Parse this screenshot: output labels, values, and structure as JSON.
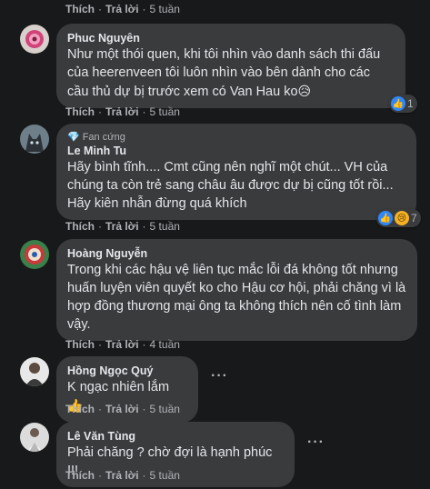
{
  "labels": {
    "like": "Thích",
    "reply": "Trả lời",
    "sep": "·",
    "fan_badge": "Fan cứng"
  },
  "top_actions": {
    "time": "5 tuần"
  },
  "comments": [
    {
      "author": "Phuc Nguyên",
      "text": "Như một thói quen, khi tôi nhìn vào danh sách thi đấu của heerenveen tôi luôn nhìn vào bên dành cho các cầu thủ dự bị trước xem có Van Hau ko",
      "emoji": "😥",
      "time": "5 tuần",
      "reaction_count": "1",
      "reactions": [
        "like-icon"
      ]
    },
    {
      "author": "Le Minh Tu",
      "text": "Hãy bình tĩnh.... Cmt cũng nên nghĩ một chút... VH của chúng ta còn trẻ sang châu âu được dự bị cũng tốt rồi... Hãy kiên nhẫn đừng quá khích",
      "time": "5 tuần",
      "reaction_count": "7",
      "reactions": [
        "like-icon",
        "sad-icon"
      ]
    },
    {
      "author": "Hoàng Nguyễn",
      "text": "Trong khi các hậu vệ liên tục mắc lỗi đá không tốt nhưng huấn luyện viên quyết ko cho Hậu cơ hội, phải chăng vì là hợp đồng thương mại ông ta không thích nên cố tình làm vậy.",
      "time": "4 tuần"
    },
    {
      "author": "Hồng Ngọc Quý",
      "text": "K ngạc nhiên lắm",
      "emoji": "👍",
      "time": "5 tuần"
    },
    {
      "author": "Lê Văn Tùng",
      "text": "Phải chăng ? chờ đợi là hạnh phúc !!!",
      "time": "5 tuần"
    }
  ]
}
